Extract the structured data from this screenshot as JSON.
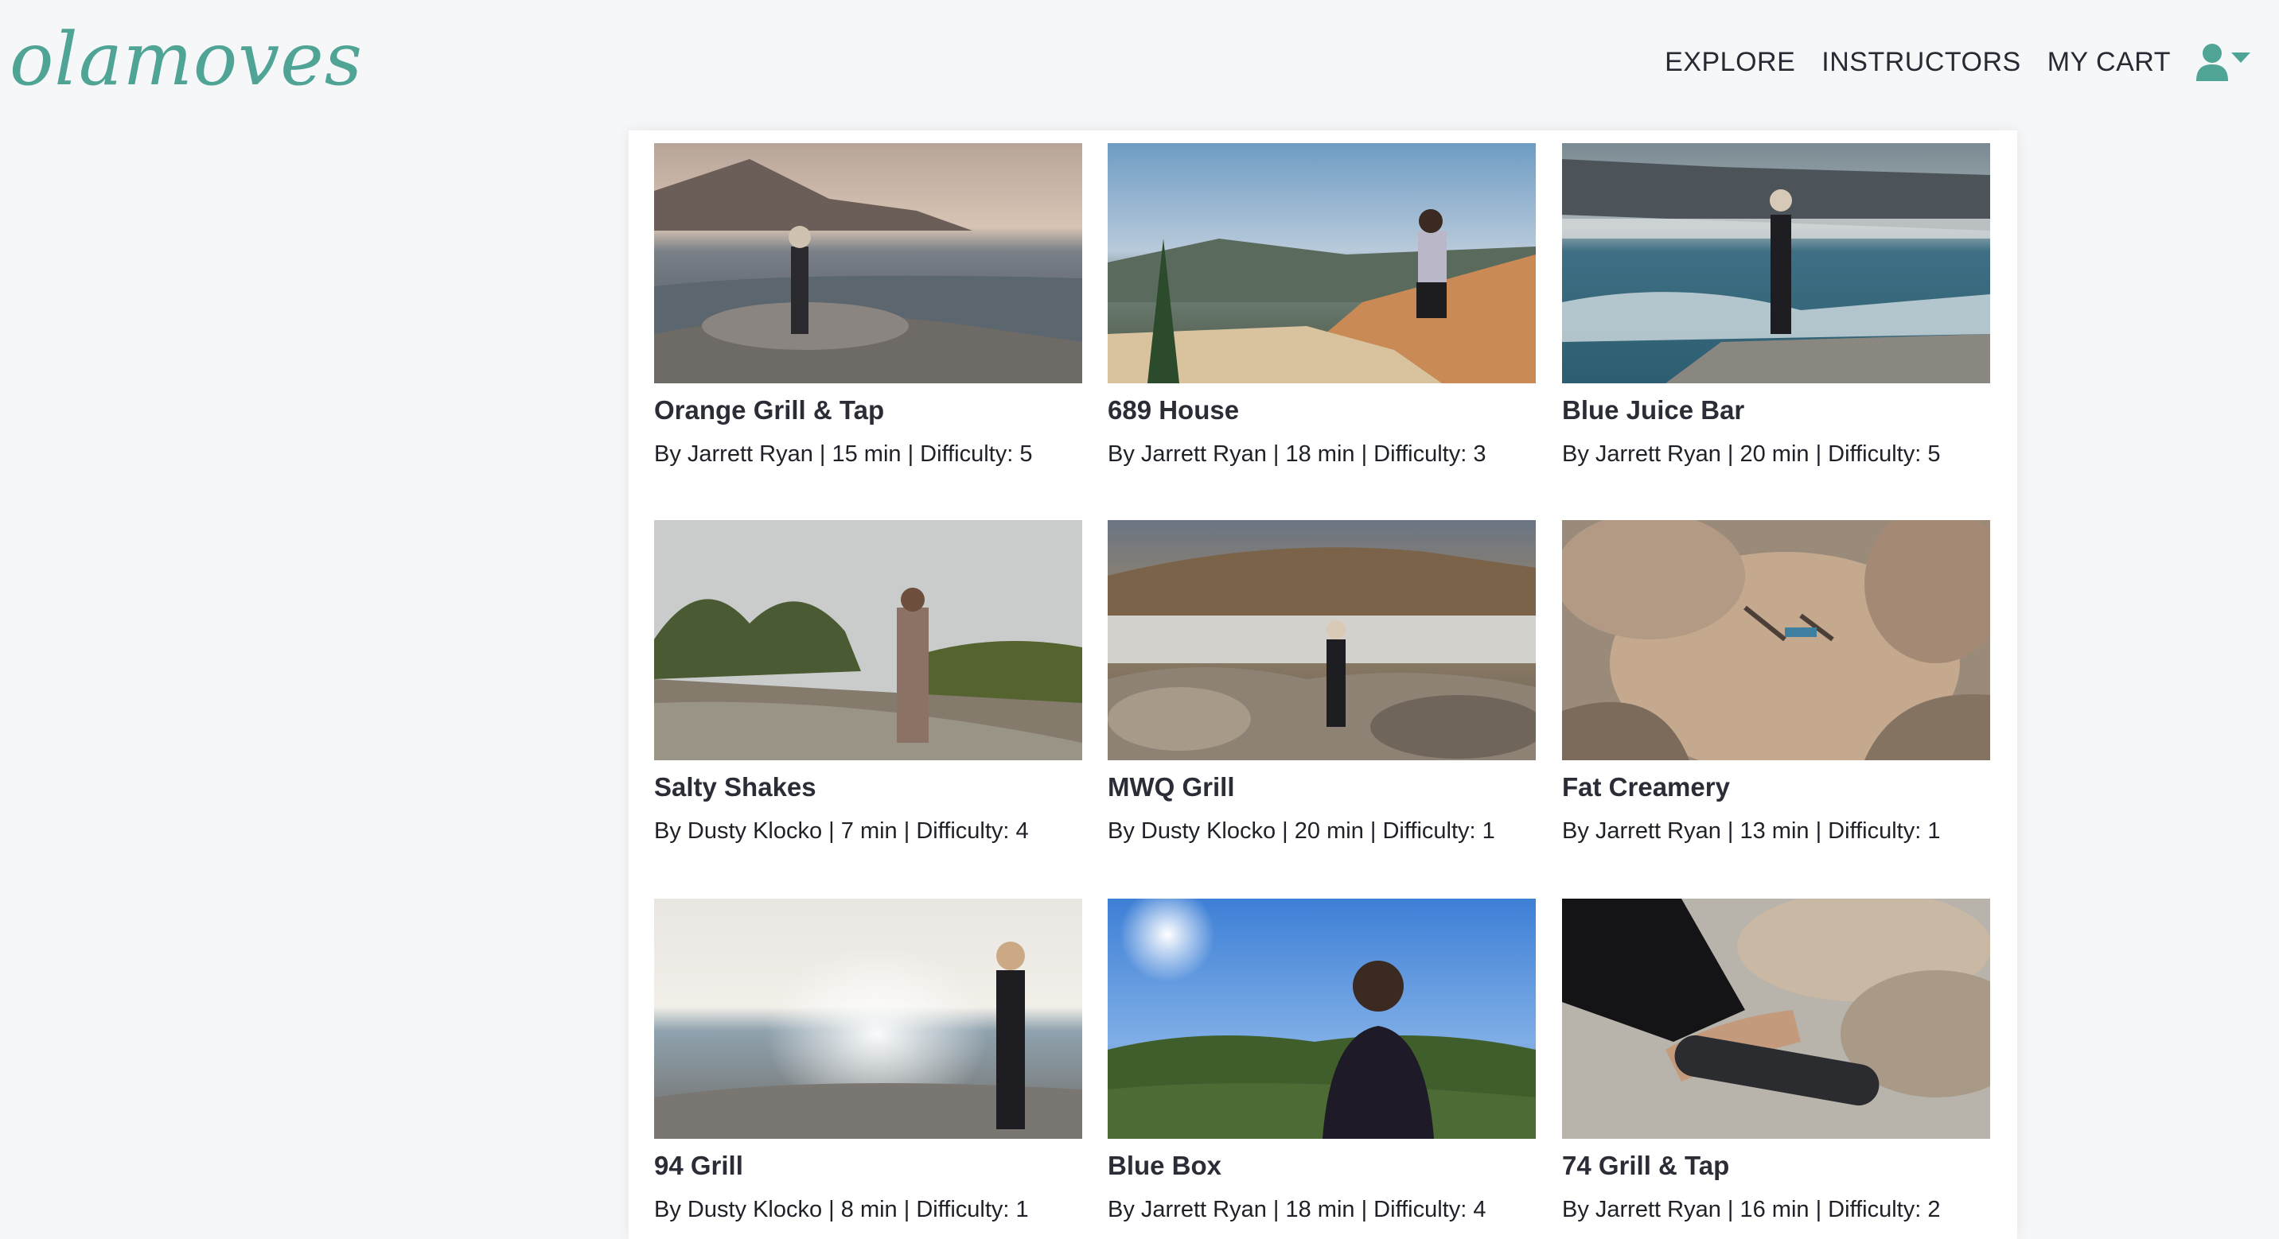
{
  "brand": {
    "logo_text": "olamoves",
    "accent_color": "#4fa495"
  },
  "nav": {
    "items": [
      {
        "label": "EXPLORE"
      },
      {
        "label": "INSTRUCTORS"
      },
      {
        "label": "MY CART"
      }
    ],
    "user_icon": "user-icon",
    "dropdown_icon": "caret-down-icon"
  },
  "classes": [
    {
      "title": "Orange Grill & Tap",
      "meta": "By Jarrett Ryan | 15 min | Difficulty: 5",
      "scene": "coast-sunset"
    },
    {
      "title": "689 House",
      "meta": "By Jarrett Ryan | 18 min | Difficulty: 3",
      "scene": "mountain-cliff"
    },
    {
      "title": "Blue Juice Bar",
      "meta": "By Jarrett Ryan | 20 min | Difficulty: 5",
      "scene": "ocean-rock"
    },
    {
      "title": "Salty Shakes",
      "meta": "By Dusty Klocko | 7 min | Difficulty: 4",
      "scene": "forest-path"
    },
    {
      "title": "MWQ Grill",
      "meta": "By Dusty Klocko | 20 min | Difficulty: 1",
      "scene": "bay-town"
    },
    {
      "title": "Fat Creamery",
      "meta": "By Jarrett Ryan | 13 min | Difficulty: 1",
      "scene": "boulders"
    },
    {
      "title": "94 Grill",
      "meta": "By Dusty Klocko | 8 min | Difficulty: 1",
      "scene": "bright-sea"
    },
    {
      "title": "Blue Box",
      "meta": "By Jarrett Ryan | 18 min | Difficulty: 4",
      "scene": "blue-sky-meditation"
    },
    {
      "title": "74 Grill & Tap",
      "meta": "By Jarrett Ryan | 16 min | Difficulty: 2",
      "scene": "mat-rolling"
    }
  ]
}
